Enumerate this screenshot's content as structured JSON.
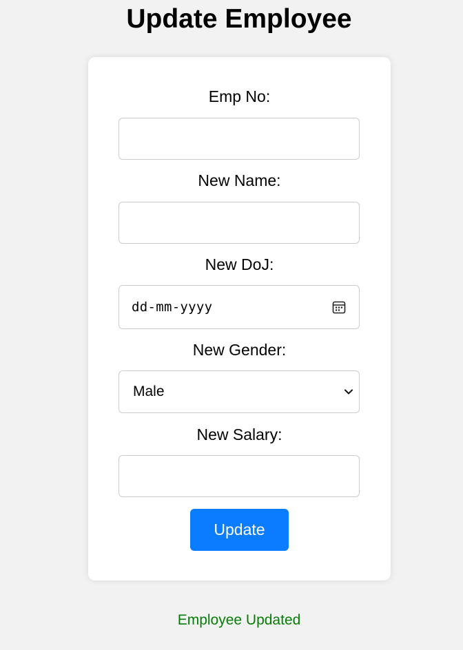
{
  "page": {
    "title": "Update Employee"
  },
  "form": {
    "emp_no": {
      "label": "Emp No:",
      "value": ""
    },
    "new_name": {
      "label": "New Name:",
      "value": ""
    },
    "new_doj": {
      "label": "New DoJ:",
      "placeholder": "dd-mm-yyyy",
      "icon": "calendar-icon"
    },
    "new_gender": {
      "label": "New Gender:",
      "selected": "Male",
      "icon": "chevron-down-icon"
    },
    "new_salary": {
      "label": "New Salary:",
      "value": ""
    },
    "submit_label": "Update"
  },
  "status": {
    "message": "Employee Updated",
    "color": "#067d06"
  },
  "colors": {
    "accent": "#0a7cff",
    "background": "#f2f2f2",
    "card": "#ffffff"
  }
}
